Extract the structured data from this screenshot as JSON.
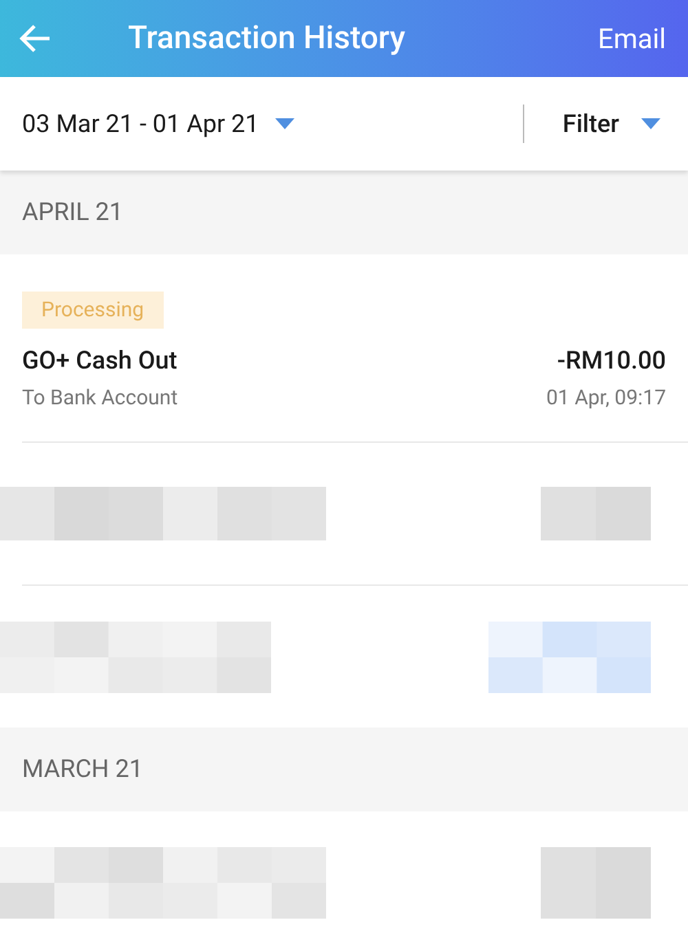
{
  "header": {
    "title": "Transaction History",
    "action": "Email"
  },
  "filter_bar": {
    "date_range": "03 Mar 21 - 01 Apr 21",
    "filter": "Filter"
  },
  "sections": [
    {
      "heading": "APRIL 21",
      "transactions": [
        {
          "kind": "normal",
          "status": "Processing",
          "title": "GO+ Cash Out",
          "subtitle": "To Bank Account",
          "amount": "-RM10.00",
          "time": "01 Apr, 09:17"
        },
        {
          "kind": "redacted"
        },
        {
          "kind": "redacted"
        }
      ]
    },
    {
      "heading": "MARCH 21",
      "transactions": [
        {
          "kind": "redacted"
        }
      ]
    }
  ]
}
